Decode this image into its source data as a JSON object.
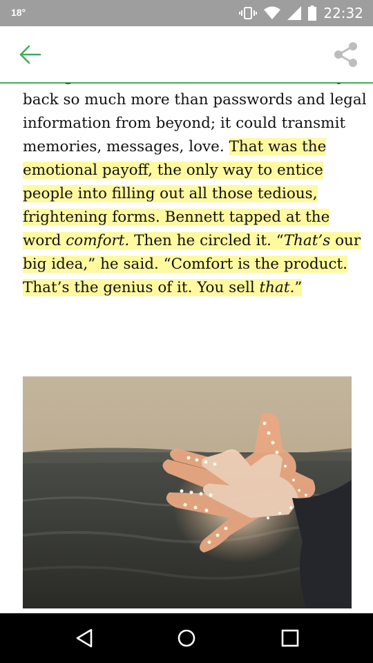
{
  "status_bar": {
    "temperature": "18°",
    "time": "22:32"
  },
  "app_bar": {
    "back_icon": "arrow-left-icon",
    "share_icon": "share-icon",
    "accent_color": "#3dae5b"
  },
  "article": {
    "lines": [
      {
        "segments": [
          {
            "text": "through in his mind. After I-Go could carry",
            "hl": false
          }
        ]
      },
      {
        "segments": [
          {
            "text": "back so much more than passwords and legal",
            "hl": false
          }
        ]
      },
      {
        "segments": [
          {
            "text": "information from beyond; it could transmit",
            "hl": false
          }
        ]
      },
      {
        "segments": [
          {
            "text": "memories, messages, love. ",
            "hl": false
          },
          {
            "text": "That was the",
            "hl": true
          }
        ]
      },
      {
        "segments": [
          {
            "text": "emotional payoff, the only way to entice",
            "hl": true
          }
        ]
      },
      {
        "segments": [
          {
            "text": "people into filling out all those tedious,",
            "hl": true
          }
        ]
      },
      {
        "segments": [
          {
            "text": "frightening forms. Bennett tapped at the",
            "hl": true
          }
        ]
      },
      {
        "segments": [
          {
            "text": "word ",
            "hl": true
          },
          {
            "text": "comfort.",
            "hl": true,
            "italic": true
          },
          {
            "text": " Then he circled it. “",
            "hl": true
          },
          {
            "text": "That’s",
            "hl": true,
            "italic": true
          },
          {
            "text": " our",
            "hl": true
          }
        ]
      },
      {
        "segments": [
          {
            "text": "big idea,” he said. “Comfort is the product.",
            "hl": true
          }
        ]
      },
      {
        "segments": [
          {
            "text": "That’s the genius of it. You sell ",
            "hl": true
          },
          {
            "text": "that.",
            "hl": true,
            "italic": true
          },
          {
            "text": "”",
            "hl": true
          }
        ]
      }
    ],
    "highlight_color": "#fff9a0"
  },
  "image": {
    "description_icon": "photo-hands-with-lights"
  },
  "nav_bar": {
    "back_icon": "triangle-back-icon",
    "home_icon": "circle-home-icon",
    "recents_icon": "square-recents-icon"
  }
}
